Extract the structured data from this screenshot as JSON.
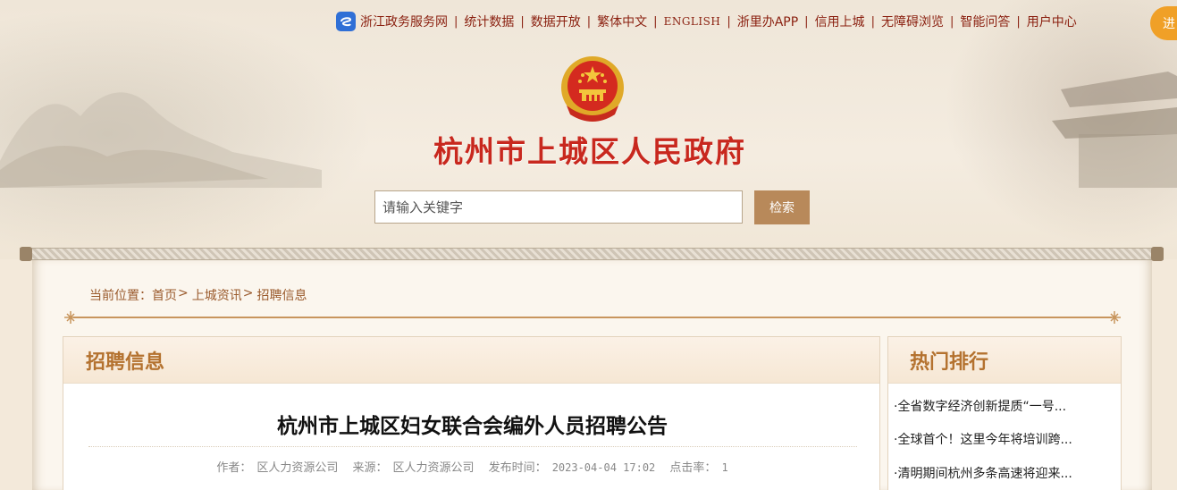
{
  "topbar": {
    "links": [
      {
        "label": "浙江政务服务网",
        "icon": "zhejiang-gov-icon"
      },
      {
        "label": "统计数据"
      },
      {
        "label": "数据开放"
      },
      {
        "label": "繁体中文"
      },
      {
        "label": "ENGLISH"
      },
      {
        "label": "浙里办APP"
      },
      {
        "label": "信用上城"
      },
      {
        "label": "无障碍浏览"
      },
      {
        "label": "智能问答"
      },
      {
        "label": "用户中心"
      }
    ],
    "user_button_label": "进"
  },
  "header": {
    "title": "杭州市上城区人民政府",
    "emblem": "national-emblem-icon"
  },
  "search": {
    "placeholder": "请输入关键字",
    "button_label": "检索"
  },
  "breadcrumb": {
    "prefix": "当前位置：",
    "items": [
      "首页",
      "上城资讯",
      "招聘信息"
    ],
    "separator": ">"
  },
  "main": {
    "section_title": "招聘信息",
    "article": {
      "title": "杭州市上城区妇女联合会编外人员招聘公告",
      "author_label": "作者：",
      "author": "区人力资源公司",
      "source_label": "来源：",
      "source": "区人力资源公司",
      "published_label": "发布时间：",
      "published": "2023-04-04 17:02",
      "clicks_label": "点击率：",
      "clicks": "1"
    }
  },
  "sidebar": {
    "title": "热门排行",
    "items": [
      "·全省数字经济创新提质“一号...",
      "·全球首个！这里今年将培训跨...",
      "·清明期间杭州多条高速将迎来..."
    ]
  },
  "colors": {
    "title_red": "#c8281e",
    "link_red": "#8a1f0f",
    "accent_brown": "#b4722f",
    "search_button": "#b8895a",
    "user_button": "#f0a027"
  }
}
